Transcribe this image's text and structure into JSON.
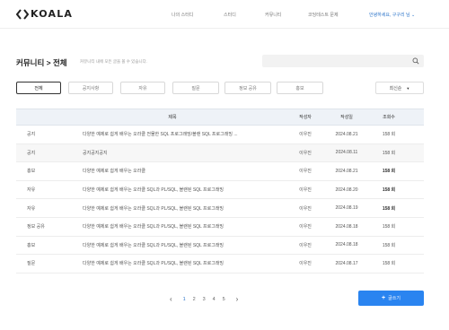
{
  "header": {
    "logo_text": "KOALA",
    "nav": [
      "나의 스터디",
      "스터디",
      "커뮤니티",
      "코딩테스트 문제"
    ],
    "user_greeting": "안녕하세요, 구구리 님",
    "user_chevron": "⌄"
  },
  "page": {
    "breadcrumb": "커뮤니티 >  전체",
    "description": "커뮤니티 내에 모든 글을 볼 수 있습니다.",
    "search_placeholder": ""
  },
  "tabs": [
    "전체",
    "공지사항",
    "자유",
    "질문",
    "정보 공유",
    "홍보"
  ],
  "sort": {
    "label": "최신순",
    "caret": "▼"
  },
  "table": {
    "headers": {
      "title": "제목",
      "author": "작성자",
      "date": "작성일",
      "views": "조회수"
    },
    "rows": [
      {
        "category": "공지",
        "title": "다양한 예제로 쉽게 배우는 오라클 전물한 SQL 프로그래밍/블랜 SQL 프로그래밍 ...",
        "author": "이우진",
        "date": "2024.08.21",
        "views": "158 회"
      },
      {
        "category": "공지",
        "title": "공지공지공지",
        "author": "이우진",
        "date": "2024.08.11",
        "views": "158 회"
      },
      {
        "category": "홍보",
        "title": "다양한 예제로 쉽게 배우는 오라클",
        "author": "이우진",
        "date": "2024.08.21",
        "views": "158 회"
      },
      {
        "category": "자유",
        "title": "다양한 예제로 쉽게 배우는 오라클 SQL과 PL/SQL, 블랜된 SQL 프로그래밍",
        "author": "이우진",
        "date": "2024.08.20",
        "views": "158 회"
      },
      {
        "category": "자유",
        "title": "다양한 예제로 쉽게 배우는 오라클 SQL과 PL/SQL, 블랜된 SQL 프로그래밍",
        "author": "이우진",
        "date": "2024.08.19",
        "views": "158 회"
      },
      {
        "category": "정보 공유",
        "title": "다양한 예제로 쉽게 배우는 오라클 SQL과 PL/SQL, 블랜된 SQL 프로그래밍",
        "author": "이우진",
        "date": "2024.08.18",
        "views": "158 회"
      },
      {
        "category": "홍보",
        "title": "다양한 예제로 쉽게 배우는 오라클 SQL과 PL/SQL, 블랜된 SQL 프로그래밍",
        "author": "이우진",
        "date": "2024.08.18",
        "views": "158 회"
      },
      {
        "category": "질문",
        "title": "다양한 예제로 쉽게 배우는 오라클 SQL과 PL/SQL, 블랜된 SQL 프로그래밍",
        "author": "이우진",
        "date": "2024.08.17",
        "views": "158 회"
      }
    ]
  },
  "pagination": {
    "prev": "‹",
    "next": "›",
    "pages": [
      "1",
      "2",
      "3",
      "4",
      "5"
    ],
    "current": "1"
  },
  "write_button": {
    "icon": "+",
    "label": "글쓰기"
  },
  "colors": {
    "accent": "#2a84f0",
    "link": "#2a73c9",
    "header_row": "#eef2f7"
  }
}
